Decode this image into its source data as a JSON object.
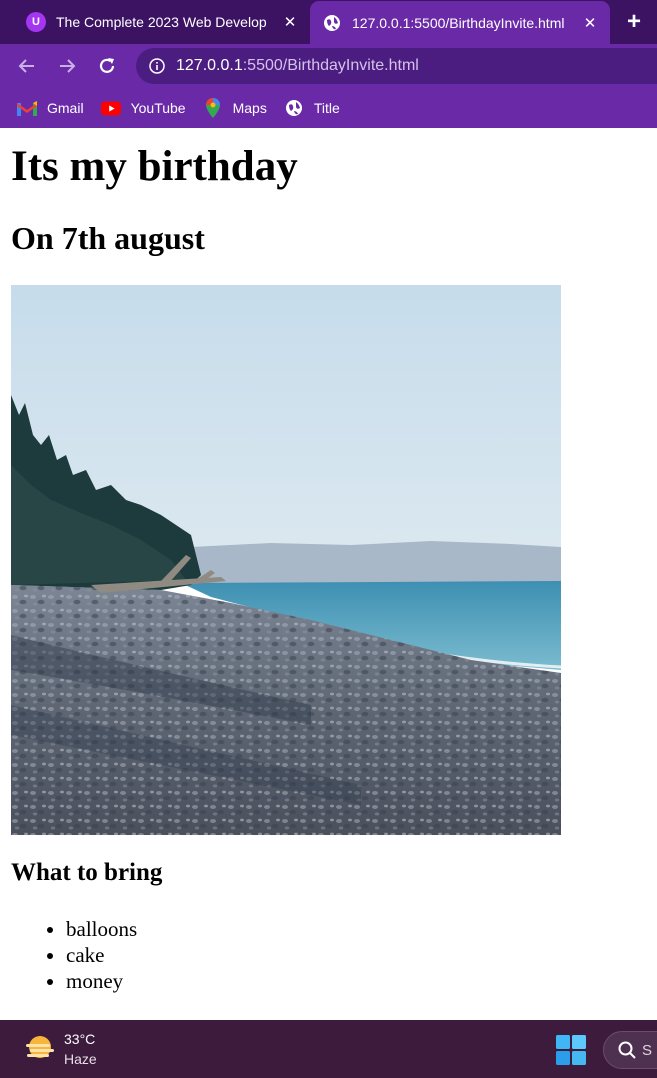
{
  "browser": {
    "tabs": [
      {
        "title": "The Complete 2023 Web Develop",
        "favicon": "udemy-icon",
        "active": false
      },
      {
        "title": "127.0.0.1:5500/BirthdayInvite.html",
        "favicon": "globe-icon",
        "active": true
      }
    ],
    "address": {
      "host": "127.0.0.1",
      "rest": ":5500/BirthdayInvite.html"
    },
    "bookmarks": [
      {
        "label": "Gmail",
        "icon": "gmail-icon"
      },
      {
        "label": "YouTube",
        "icon": "youtube-icon"
      },
      {
        "label": "Maps",
        "icon": "maps-icon"
      },
      {
        "label": "Title",
        "icon": "globe-icon"
      }
    ],
    "colors": {
      "tabstrip": "#3c1263",
      "toolbar": "#6a2aa8"
    }
  },
  "page": {
    "heading": "Its my birthday",
    "subheading": "On 7th august",
    "image": {
      "subject": "pebble beach with sea and trees"
    },
    "list_heading": "What to bring",
    "items": [
      "balloons",
      "cake",
      "money"
    ]
  },
  "taskbar": {
    "weather_temp": "33°C",
    "weather_desc": "Haze",
    "search_text": "S"
  }
}
